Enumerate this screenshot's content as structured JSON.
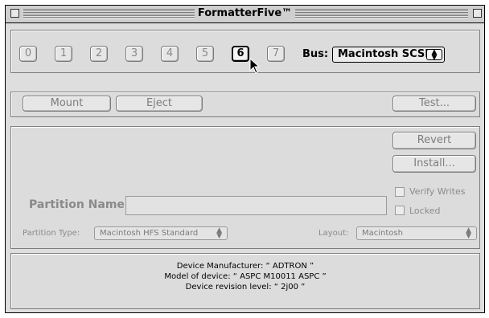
{
  "window": {
    "title": "FormatterFive™"
  },
  "scsi_ids": [
    {
      "label": "0"
    },
    {
      "label": "1"
    },
    {
      "label": "2"
    },
    {
      "label": "3"
    },
    {
      "label": "4"
    },
    {
      "label": "5"
    },
    {
      "label": "6"
    },
    {
      "label": "7"
    }
  ],
  "selected_id": "6",
  "bus": {
    "label": "Bus:",
    "value": "Macintosh SCSI"
  },
  "actions": {
    "mount": "Mount",
    "eject": "Eject",
    "test": "Test..."
  },
  "partition": {
    "revert": "Revert",
    "install": "Install...",
    "verify_writes": "Verify Writes",
    "locked": "Locked",
    "name_label": "Partition Name:",
    "name_value": "",
    "type_label": "Partition Type:",
    "type_value": "Macintosh HFS Standard",
    "layout_label": "Layout:",
    "layout_value": "Macintosh"
  },
  "device": {
    "manufacturer": "Device Manufacturer: “ ADTRON ”",
    "model": "Model of device: “ ASPC M10011 ASPC ”",
    "revision": "Device revision level: “ 2j00 ”"
  },
  "colors": {
    "window_bg": "#dedede",
    "disabled_text": "#8a8a8a"
  }
}
